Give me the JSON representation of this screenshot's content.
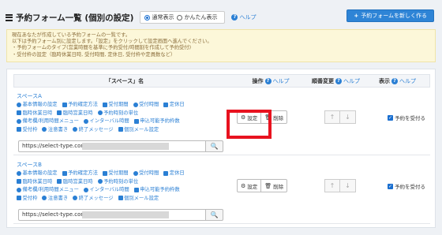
{
  "header": {
    "title": "予約フォーム一覧 (個別の設定)",
    "modes": [
      "通常表示",
      "かんたん表示"
    ],
    "selected_mode_index": 0,
    "help": "ヘルプ",
    "new_button": "予約フォームを新しく作る"
  },
  "notice": {
    "lines": [
      "現在あなたが作成している予約フォームの一覧です。",
      "以下は予約フォーム別に設定します。「設定」をクリックして設定画面へ進んでください。",
      "・予約フォームのタイプ(営業時間を基準に予約受付/時間割を作成して予約受付)",
      "・受付枠の設定（臨時休業日時, 受付時間, 定休日, 受付枠や定員数など）"
    ]
  },
  "table": {
    "headers": {
      "name": "「スペース」名",
      "ops": "操作",
      "ops_help": "ヘルプ",
      "sort": "順番変更",
      "sort_help": "ヘルプ",
      "display": "表示",
      "display_help": "ヘルプ"
    },
    "rows": [
      {
        "name": "スペースA",
        "url": "https://select-type.com/rsv/?id=",
        "settings_label": "設定",
        "delete_label": "削除",
        "publish_label": "予約を受付る"
      },
      {
        "name": "スペースB",
        "url": "https://select-type.com/rsv/?id=",
        "settings_label": "設定",
        "delete_label": "削除",
        "publish_label": "予約を受付る"
      }
    ],
    "link_items": [
      [
        "基本情報の設定",
        "予約確定方法",
        "受付期間",
        "受付時間",
        "定休日"
      ],
      [
        "臨時休業日時",
        "臨時営業日時",
        "予約時刻の単位"
      ],
      [
        "備考欄/利用時間メニュー",
        "インターバル時間",
        "申込可能予約枠数"
      ],
      [
        "受付枠",
        "注意書き",
        "終了メッセージ",
        "個別メール設定"
      ]
    ]
  },
  "colors": {
    "accent": "#2a7fd4",
    "highlight": "#e8121f",
    "notice_bg": "#fcf7d9"
  }
}
